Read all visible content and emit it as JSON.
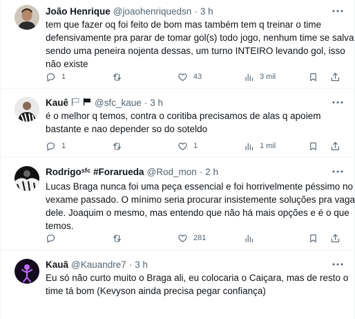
{
  "tweets": [
    {
      "name": "João Henrique",
      "handle": "@joaohenriquedsn",
      "sep": "·",
      "time": "3 h",
      "lines": [
        "tem que fazer oq foi feito de bom mas também tem q treinar o time",
        "defensivamente pra parar de tomar gol(s) todo jogo, nenhum time se salva",
        "sendo uma peneira nojenta dessas, um turno INTEIRO levando gol, isso",
        "não existe"
      ],
      "replies": "1",
      "retweets": "",
      "likes": "43",
      "views": "3 mil"
    },
    {
      "name": "Kauê",
      "handle": "@sfc_kaue",
      "sep": "·",
      "time": "3 h",
      "lines": [
        "é  o melhor q temos, contra o coritiba precisamos de alas q apoiem",
        "bastante e nao depender so do soteldo"
      ],
      "replies": "1",
      "retweets": "",
      "likes": "1",
      "views": "1 mil"
    },
    {
      "name": "Rodrigoˢᶠᶜ #Forarueda",
      "handle": "@Rod_mon",
      "sep": "·",
      "time": "2 h",
      "lines": [
        "Lucas Braga nunca foi uma peça essencial e foi horrivelmente péssimo no",
        "vexame passado. O mínimo seria procurar insistemente soluções pra vaga",
        "dele. Joaquim o mesmo, mas entendo que não há mais opções e é o que",
        "temos."
      ],
      "replies": "",
      "retweets": "",
      "likes": "281",
      "views": ""
    },
    {
      "name": "Kauã",
      "handle": "@Kauandre7",
      "sep": "·",
      "time": "3 h",
      "lines": [
        "Eu só não curto muito o Braga ali, eu colocaria o Caiçara, mas de resto o",
        "time tá bom (Kevyson ainda precisa pegar confiança)"
      ]
    }
  ]
}
